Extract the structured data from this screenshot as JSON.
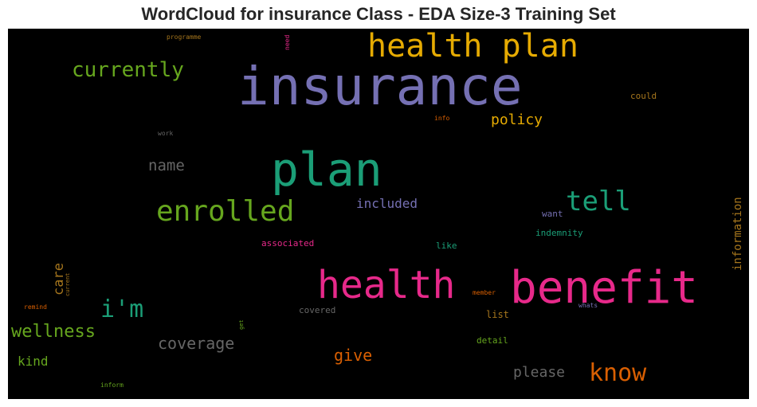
{
  "title": "WordCloud for insurance Class - EDA Size-3 Training Set",
  "colors": {
    "background": "#000000",
    "title": "#262626"
  },
  "words": [
    {
      "id": "insurance",
      "text": "insurance",
      "color": "#7570b3"
    },
    {
      "id": "health-plan",
      "text": "health plan",
      "color": "#e6ab02"
    },
    {
      "id": "plan",
      "text": "plan",
      "color": "#1b9e77"
    },
    {
      "id": "health",
      "text": "health",
      "color": "#e7298a"
    },
    {
      "id": "benefit",
      "text": "benefit",
      "color": "#e7298a"
    },
    {
      "id": "enrolled",
      "text": "enrolled",
      "color": "#66a61e"
    },
    {
      "id": "currently",
      "text": "currently",
      "color": "#66a61e"
    },
    {
      "id": "tell",
      "text": "tell",
      "color": "#1b9e77"
    },
    {
      "id": "know",
      "text": "know",
      "color": "#d95f02"
    },
    {
      "id": "im",
      "text": "i'm",
      "color": "#1b9e77"
    },
    {
      "id": "wellness",
      "text": "wellness",
      "color": "#66a61e"
    },
    {
      "id": "name",
      "text": "name",
      "color": "#666666"
    },
    {
      "id": "policy",
      "text": "policy",
      "color": "#e6ab02"
    },
    {
      "id": "coverage",
      "text": "coverage",
      "color": "#666666"
    },
    {
      "id": "please",
      "text": "please",
      "color": "#666666"
    },
    {
      "id": "give",
      "text": "give",
      "color": "#d95f02"
    },
    {
      "id": "included",
      "text": "included",
      "color": "#7570b3"
    },
    {
      "id": "care",
      "text": "care",
      "color": "#a6761d"
    },
    {
      "id": "kind",
      "text": "kind",
      "color": "#66a61e"
    },
    {
      "id": "information",
      "text": "information",
      "color": "#a6761d"
    },
    {
      "id": "associated",
      "text": "associated",
      "color": "#e7298a"
    },
    {
      "id": "indemnity",
      "text": "indemnity",
      "color": "#1b9e77"
    },
    {
      "id": "want",
      "text": "want",
      "color": "#7570b3"
    },
    {
      "id": "like",
      "text": "like",
      "color": "#1b9e77"
    },
    {
      "id": "could",
      "text": "could",
      "color": "#a6761d"
    },
    {
      "id": "covered",
      "text": "covered",
      "color": "#666666"
    },
    {
      "id": "list",
      "text": "list",
      "color": "#a6761d"
    },
    {
      "id": "detail",
      "text": "detail",
      "color": "#66a61e"
    },
    {
      "id": "member",
      "text": "member",
      "color": "#d95f02"
    },
    {
      "id": "whats",
      "text": "whats",
      "color": "#7570b3"
    },
    {
      "id": "info",
      "text": "info",
      "color": "#d95f02"
    },
    {
      "id": "work",
      "text": "work",
      "color": "#666666"
    },
    {
      "id": "programme",
      "text": "programme",
      "color": "#a6761d"
    },
    {
      "id": "need",
      "text": "need",
      "color": "#e7298a"
    },
    {
      "id": "remind",
      "text": "remind",
      "color": "#d95f02"
    },
    {
      "id": "current",
      "text": "current",
      "color": "#a6761d"
    },
    {
      "id": "get",
      "text": "get",
      "color": "#66a61e"
    },
    {
      "id": "inform",
      "text": "inform",
      "color": "#66a61e"
    }
  ]
}
